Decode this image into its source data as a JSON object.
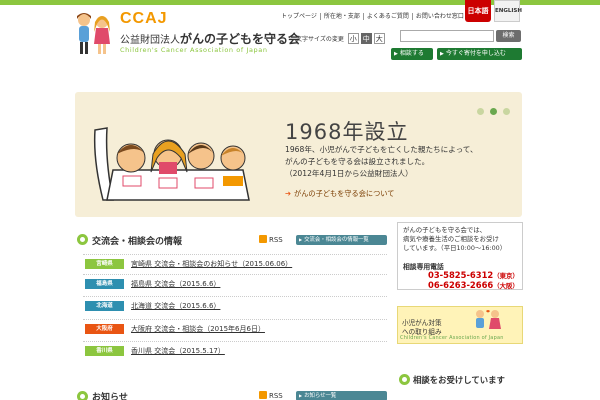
{
  "header": {
    "logo": {
      "acronym": "CCAJ",
      "org_prefix": "公益財団法人",
      "org_name": "がんの子どもを守る会",
      "english": "Children's Cancer Association of Japan"
    },
    "top_nav": [
      "トップページ",
      "所在地・支部",
      "よくあるご質問",
      "お問い合わせ窓口"
    ],
    "lang": {
      "jp": "日本語",
      "en": "ENGLISH"
    },
    "font_size": {
      "label": "文字サイズの変更",
      "options": [
        "小",
        "中",
        "大"
      ],
      "selected": "中"
    },
    "search": {
      "button": "検索",
      "value": ""
    },
    "buttons": {
      "consult": "相談する",
      "donate": "今すぐ寄付を申し込む"
    }
  },
  "banner": {
    "title": "1968年設立",
    "body": [
      "1968年、小児がんで子どもを亡くした親たちによって、",
      "がんの子どもを守る会は設立されました。",
      "（2012年4月1日から公益財団法人）"
    ],
    "link": "がんの子どもを守る会について",
    "slides": 3,
    "active_slide": 2
  },
  "events": {
    "title": "交流会・相談会の情報",
    "rss": "RSS",
    "list_button": "交流会・相談会の情報一覧",
    "rows": [
      {
        "region": "宮崎県",
        "color": "#8cc63f",
        "text": "宮崎県 交流会・相談会のお知らせ（2015.06.06）"
      },
      {
        "region": "福島県",
        "color": "#2e8fb0",
        "text": "福島県 交流会（2015.6.6）"
      },
      {
        "region": "北海道",
        "color": "#2e8fb0",
        "text": "北海道 交流会（2015.6.6）"
      },
      {
        "region": "大阪府",
        "color": "#e95513",
        "text": "大阪府 交流会・相談会（2015年6月6日）"
      },
      {
        "region": "香川県",
        "color": "#8cc63f",
        "text": "香川県 交流会（2015.5.17）"
      }
    ]
  },
  "news": {
    "title": "お知らせ",
    "rss": "RSS",
    "list_button": "お知らせ一覧"
  },
  "sidebar": {
    "info_lines": [
      "がんの子どもを守る会では、",
      "病気や療養生活のご相談をお受け",
      "しています。（平日10:00〜16:00）"
    ],
    "phone_label": "相談専用電話",
    "phones": [
      {
        "number": "03-5825-6312",
        "area": "（東京）"
      },
      {
        "number": "06-6263-2666",
        "area": "（大阪）"
      }
    ],
    "campaign_lines": [
      "小児がん対策",
      "への取り組み"
    ],
    "campaign_en": "Children's Cancer Association of Japan",
    "section_title": "相談をお受けしています"
  },
  "colors": {
    "brand_green": "#8cc63f",
    "dark_green": "#1e7a32",
    "brand_orange": "#f39800",
    "red": "#cc0000"
  }
}
